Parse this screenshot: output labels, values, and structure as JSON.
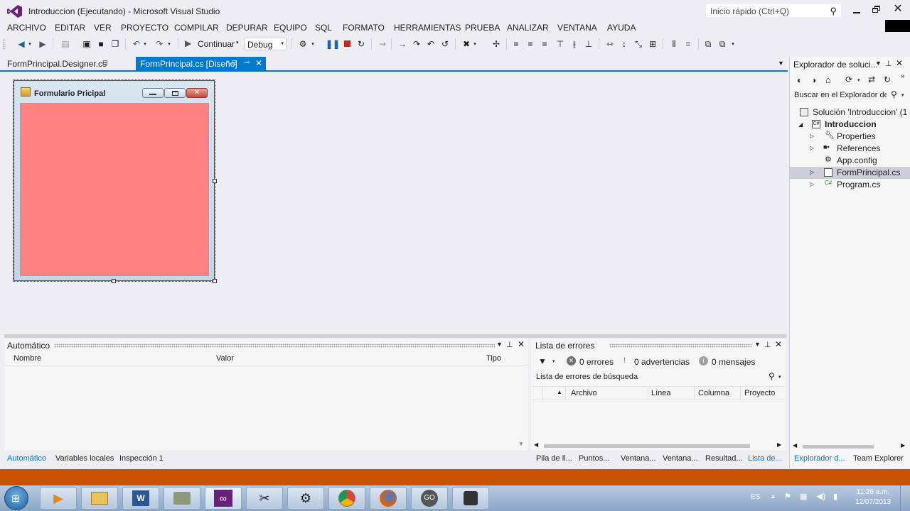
{
  "window": {
    "title": "Introduccion (Ejecutando) - Microsoft Visual Studio",
    "quick_launch_placeholder": "Inicio rápido (Ctrl+Q)"
  },
  "menu": [
    "ARCHIVO",
    "EDITAR",
    "VER",
    "PROYECTO",
    "COMPILAR",
    "DEPURAR",
    "EQUIPO",
    "SQL",
    "FORMATO",
    "HERRAMIENTAS",
    "PRUEBA",
    "ANALIZAR",
    "VENTANA",
    "AYUDA"
  ],
  "toolbar": {
    "continue_label": "Continuar",
    "config_value": "Debug"
  },
  "doc_tabs": {
    "tab1": "FormPrincipal.Designer.cs",
    "tab2": "FormPrincipal.cs [Diseño]"
  },
  "form": {
    "title": "Formulario Pricipal",
    "back_color": "#ff8080"
  },
  "solution_explorer": {
    "title": "Explorador de soluci...",
    "search_placeholder": "Buscar en el Explorador de",
    "items": [
      {
        "label": "Solución 'Introduccion' (1"
      },
      {
        "label": "Introduccion"
      },
      {
        "label": "Properties"
      },
      {
        "label": "References"
      },
      {
        "label": "App.config"
      },
      {
        "label": "FormPrincipal.cs"
      },
      {
        "label": "Program.cs"
      }
    ]
  },
  "autos_panel": {
    "title": "Automático",
    "columns": [
      "Nombre",
      "Valor",
      "Tipo"
    ]
  },
  "error_list": {
    "title": "Lista de errores",
    "errors": "0 errores",
    "warnings": "0 advertencias",
    "messages": "0 mensajes",
    "search_placeholder": "Lista de errores de búsqueda",
    "columns": [
      "Archivo",
      "Línea",
      "Columna",
      "Proyecto"
    ]
  },
  "bottom_tabs_left": [
    "Automático",
    "Variables locales",
    "Inspección 1"
  ],
  "bottom_tabs_right": [
    "Pila de ll...",
    "Puntos...",
    "Ventana...",
    "Ventana...",
    "Resultad...",
    "Lista de..."
  ],
  "bottom_tabs_solexp": [
    "Explorador d...",
    "Team Explorer"
  ],
  "taskbar": {
    "language": "ES",
    "time": "11:26 a.m.",
    "date": "12/07/2013"
  },
  "colors": {
    "accent": "#007acc",
    "status_bar": "#ca5100",
    "vs_purple": "#68217a"
  }
}
